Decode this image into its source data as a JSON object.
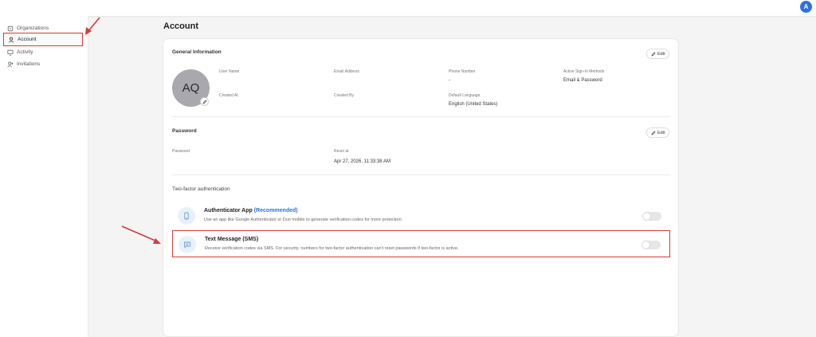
{
  "header": {
    "user_initial": "A"
  },
  "sidebar": {
    "items": [
      {
        "label": "Organizations",
        "icon": "building-icon",
        "active": false
      },
      {
        "label": "Account",
        "icon": "user-icon",
        "active": true
      },
      {
        "label": "Activity",
        "icon": "monitor-icon",
        "active": false
      },
      {
        "label": "Invitations",
        "icon": "user-plus-icon",
        "active": false
      }
    ]
  },
  "main": {
    "title": "Account",
    "general": {
      "title": "General Information",
      "edit_label": "Edit",
      "avatar_initials": "AQ",
      "fields": {
        "user_name": {
          "label": "User Name",
          "value": ""
        },
        "email": {
          "label": "Email Address",
          "value": ""
        },
        "phone": {
          "label": "Phone Number",
          "value": "-"
        },
        "signin": {
          "label": "Active Sign-In Methods",
          "value": "Email & Password"
        },
        "created_at": {
          "label": "Created At",
          "value": ""
        },
        "created_by": {
          "label": "Created By",
          "value": ""
        },
        "language": {
          "label": "Default Language",
          "value": "English (United States)"
        }
      }
    },
    "password": {
      "title": "Password",
      "edit_label": "Edit",
      "password_label": "Password",
      "reset_label": "Reset at",
      "reset_value": "Apr 27, 2026, 11:33:38 AM"
    },
    "tfa": {
      "title": "Two-factor authentication",
      "methods": [
        {
          "name": "Authenticator App",
          "recommended": "(Recommended)",
          "description": "Use an app like Google Authenticator or Duo mobile to generate verification codes for more protection.",
          "enabled": false
        },
        {
          "name": "Text Message (SMS)",
          "recommended": "",
          "description": "Receive verification codes via SMS. For security, numbers for two-factor authentication can't reset passwords if two-factor is active.",
          "enabled": false
        }
      ]
    }
  },
  "colors": {
    "accent": "#2f6fe0",
    "annotation": "#d43c3c",
    "avatar": "#a9a8ae"
  }
}
